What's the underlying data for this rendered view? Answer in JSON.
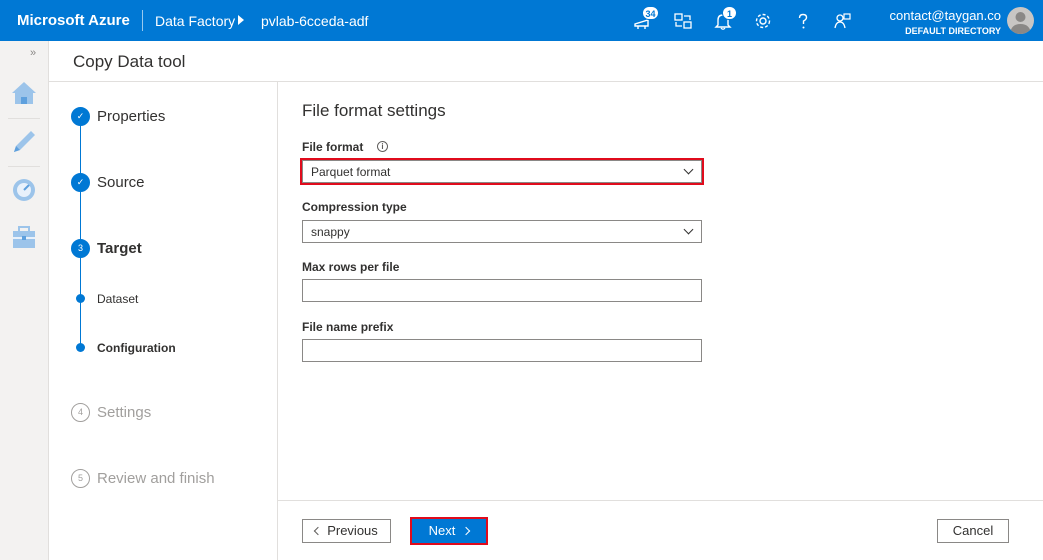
{
  "topbar": {
    "brand": "Microsoft Azure",
    "breadcrumb_service": "Data Factory",
    "breadcrumb_resource": "pvlab-6cceda-adf",
    "notifications_updates_count": "34",
    "notifications_count": "1",
    "user_email": "contact@taygan.co",
    "user_directory": "DEFAULT DIRECTORY",
    "icons": [
      "feedback-updates-icon",
      "switch-directory-icon",
      "notifications-icon",
      "settings-icon",
      "help-icon",
      "feedback-icon"
    ]
  },
  "rail": {
    "expand_glyph": "»",
    "items": [
      "home-icon",
      "author-icon",
      "monitor-icon",
      "manage-icon"
    ]
  },
  "header": {
    "title": "Copy Data tool"
  },
  "steps": [
    {
      "number": "✓",
      "label": "Properties",
      "state": "done"
    },
    {
      "number": "✓",
      "label": "Source",
      "state": "done"
    },
    {
      "number": "3",
      "label": "Target",
      "state": "current",
      "substeps": [
        {
          "label": "Dataset",
          "active": false
        },
        {
          "label": "Configuration",
          "active": true
        }
      ]
    },
    {
      "number": "4",
      "label": "Settings",
      "state": "future"
    },
    {
      "number": "5",
      "label": "Review and finish",
      "state": "future"
    }
  ],
  "form": {
    "title": "File format settings",
    "file_format": {
      "label": "File format",
      "info_glyph": "i",
      "value": "Parquet format"
    },
    "compression_type": {
      "label": "Compression type",
      "value": "snappy"
    },
    "max_rows_per_file": {
      "label": "Max rows per file",
      "value": ""
    },
    "file_name_prefix": {
      "label": "File name prefix",
      "value": ""
    }
  },
  "footer": {
    "previous_label": "Previous",
    "next_label": "Next",
    "cancel_label": "Cancel"
  },
  "colors": {
    "accent": "#0078d4",
    "highlight": "#e00b1c"
  }
}
